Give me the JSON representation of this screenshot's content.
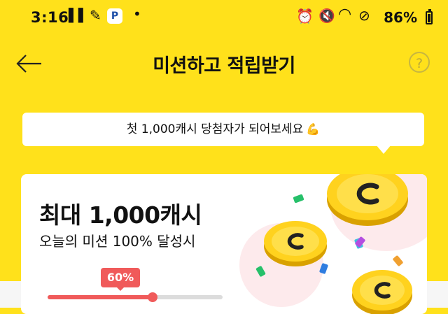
{
  "status_bar": {
    "time": "3:16",
    "battery": "86%"
  },
  "header": {
    "title": "미션하고 적립받기",
    "help_icon": "?"
  },
  "banner": {
    "text": "첫 1,000캐시 당첨자가 되어보세요",
    "emoji": "💪"
  },
  "card": {
    "headline": "최대 1,000캐시",
    "subline": "오늘의 미션 100% 달성시",
    "progress_label": "60%",
    "progress": 0.6
  },
  "colors": {
    "background": "#FFE11B",
    "accent": "#F05A5A"
  }
}
